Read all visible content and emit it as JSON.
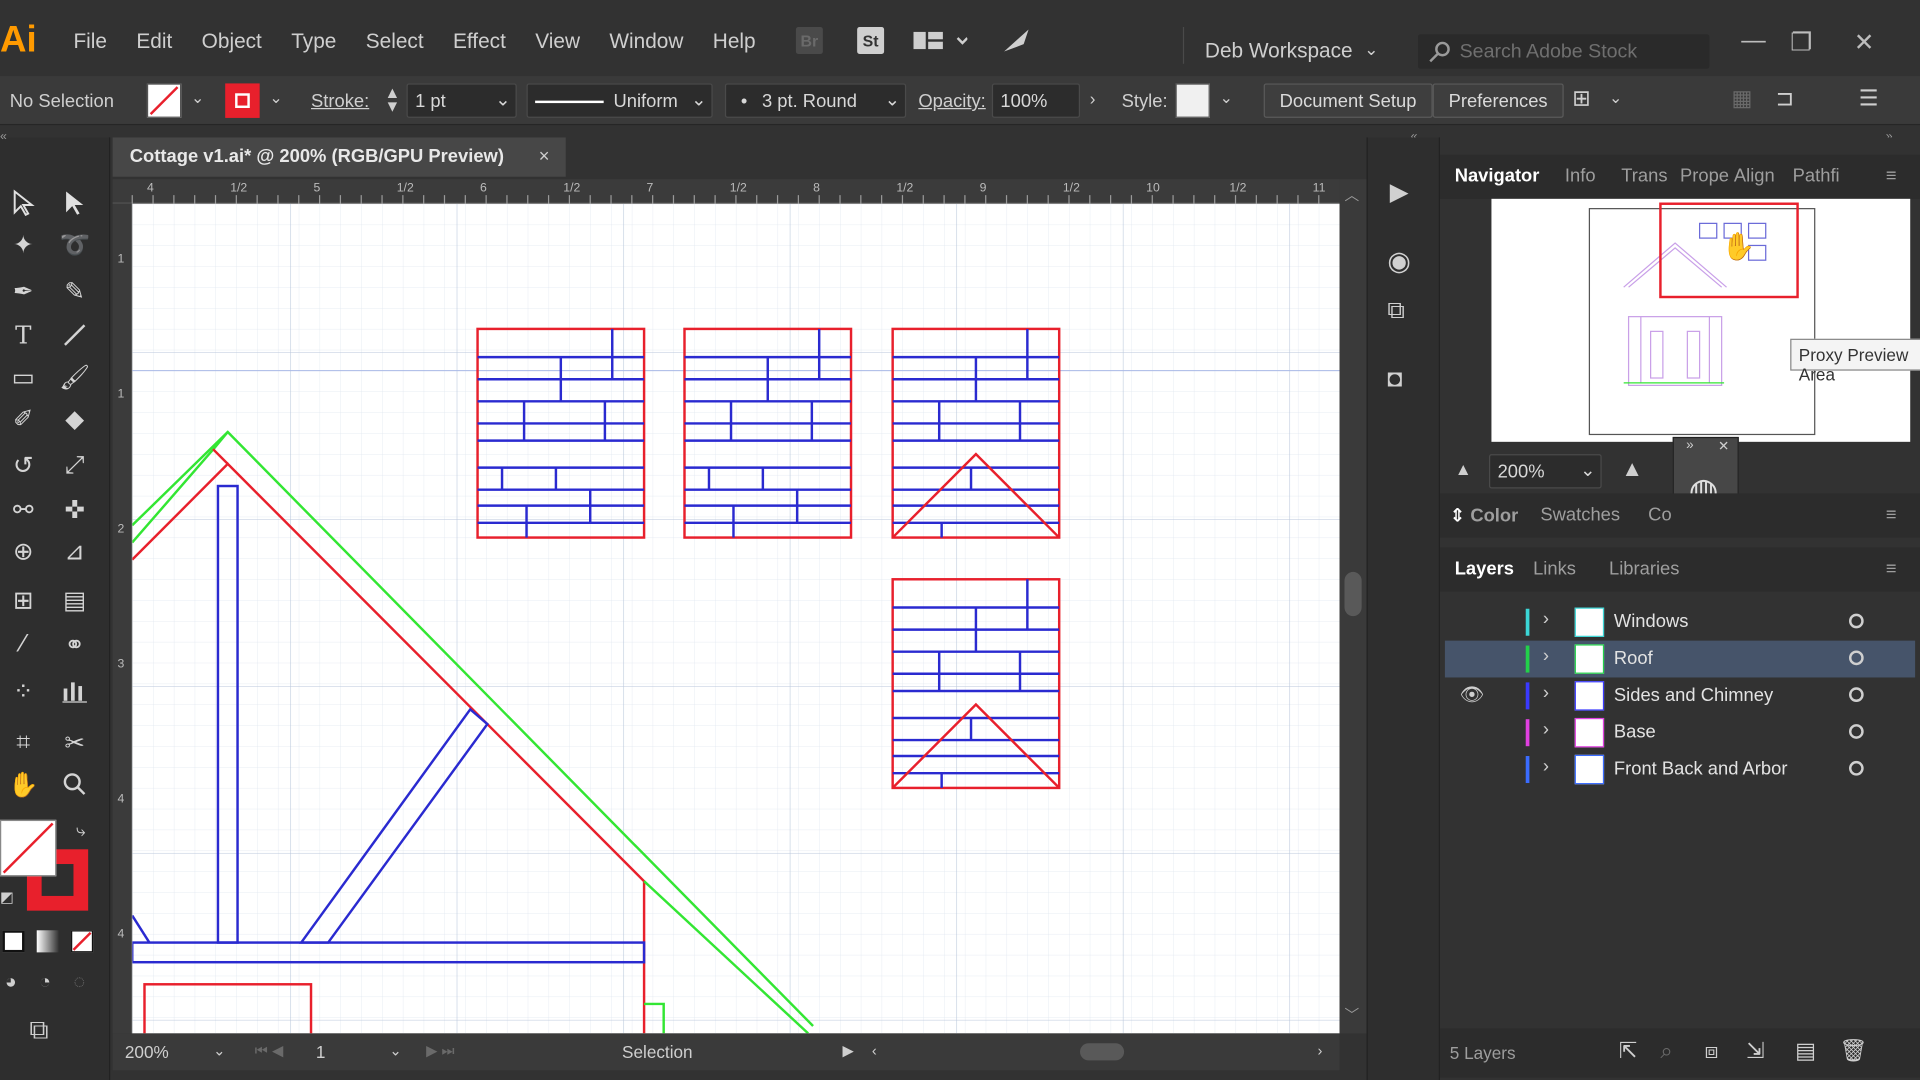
{
  "app": {
    "logo": "Ai",
    "workspace": "Deb Workspace",
    "search_placeholder": "Search Adobe Stock"
  },
  "menu": [
    "File",
    "Edit",
    "Object",
    "Type",
    "Select",
    "Effect",
    "View",
    "Window",
    "Help"
  ],
  "appbar_icons": {
    "br": "Br",
    "st": "St"
  },
  "control": {
    "selection": "No Selection",
    "stroke_label": "Stroke:",
    "stroke_weight": "1 pt",
    "profile": "Uniform",
    "brush": "3 pt. Round",
    "opacity_label": "Opacity:",
    "opacity": "100%",
    "style_label": "Style:",
    "document_setup": "Document Setup",
    "preferences": "Preferences"
  },
  "document": {
    "tab_title": "Cottage v1.ai* @ 200% (RGB/GPU Preview)",
    "close": "×"
  },
  "ruler": {
    "top_labels": [
      "4",
      "1/2",
      "5",
      "1/2",
      "6",
      "1/2",
      "7",
      "1/2",
      "8",
      "1/2",
      "9",
      "1/2",
      "10",
      "1/2",
      "11"
    ],
    "left_labels": [
      "1",
      "1",
      "2",
      "3",
      "4",
      "4"
    ]
  },
  "status": {
    "zoom": "200%",
    "artboard": "1",
    "tool": "Selection"
  },
  "navigator": {
    "tabs": [
      "Navigator",
      "Info",
      "Trans",
      "Prope",
      "Align",
      "Pathfi"
    ],
    "zoom": "200%",
    "tooltip": "Proxy Preview Area"
  },
  "color_tabs": [
    "Color",
    "Swatches",
    "Co"
  ],
  "layers_tabs": [
    "Layers",
    "Links",
    "Libraries"
  ],
  "layers": [
    {
      "name": "Windows",
      "color": "#3bd6d6",
      "visible": false,
      "selected": false
    },
    {
      "name": "Roof",
      "color": "#22d14a",
      "visible": false,
      "selected": true
    },
    {
      "name": "Sides and Chimney",
      "color": "#3a3aff",
      "visible": true,
      "selected": false
    },
    {
      "name": "Base",
      "color": "#e040e0",
      "visible": false,
      "selected": false
    },
    {
      "name": "Front Back and Arbor",
      "color": "#3a6cff",
      "visible": false,
      "selected": false
    }
  ],
  "layers_count": "5 Layers",
  "colors": {
    "accent_red": "#e8202c",
    "brick_blue": "#2a2ad0",
    "roof_green": "#33e633",
    "ui_bg": "#323232"
  }
}
